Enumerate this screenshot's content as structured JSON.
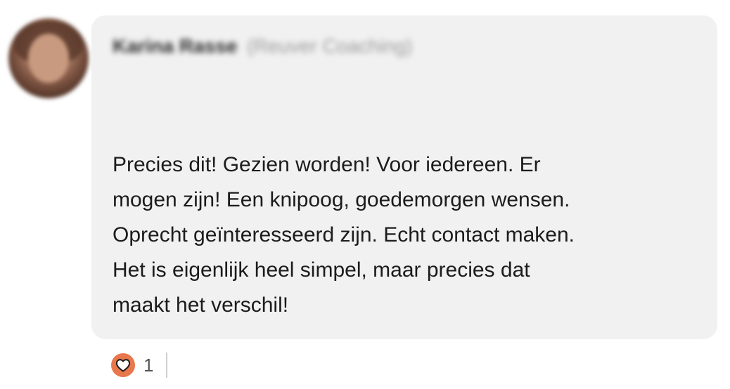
{
  "comment": {
    "author_name": "Karina Rasse",
    "author_role": "(Reuver Coaching)",
    "text_lines": [
      "Precies dit! Gezien worden! Voor iedereen. Er",
      "mogen zijn! Een knipoog, goedemorgen wensen.",
      "Oprecht geïnteresseerd zijn. Echt contact maken.",
      "Het is eigenlijk heel simpel, maar precies dat",
      "maakt het verschil!"
    ]
  },
  "reactions": {
    "icon": "heart-icon",
    "count": "1",
    "accent_color": "#e9774d"
  }
}
